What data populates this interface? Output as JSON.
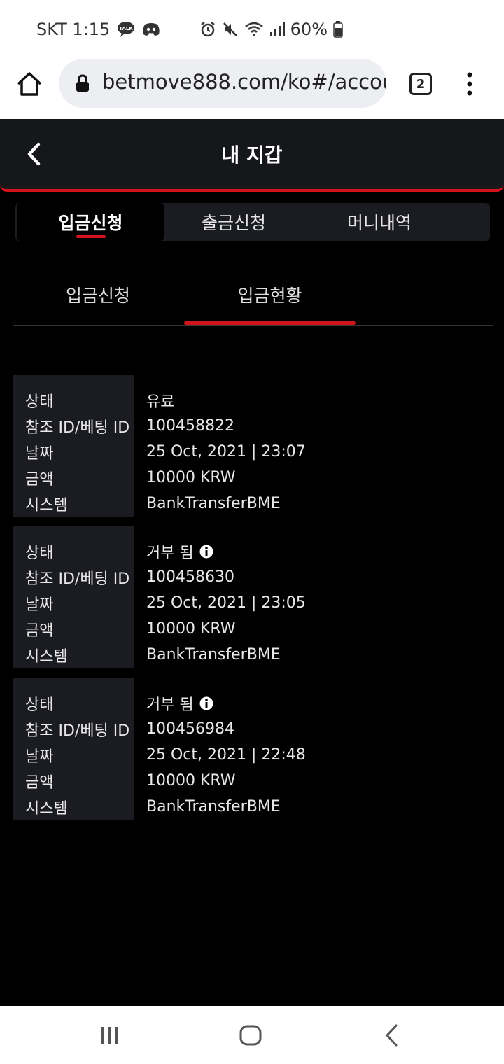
{
  "status_bar": {
    "carrier_time": "SKT 1:15",
    "battery": "60%"
  },
  "browser": {
    "url": "betmove888.com/ko#/account",
    "tab_count": "2"
  },
  "header": {
    "title": "내 지갑"
  },
  "main_tabs": [
    {
      "label": "입금신청",
      "active": true
    },
    {
      "label": "출금신청",
      "active": false
    },
    {
      "label": "머니내역",
      "active": false
    }
  ],
  "sub_tabs": [
    {
      "label": "입금신청",
      "active": false
    },
    {
      "label": "입금현황",
      "active": true
    }
  ],
  "field_labels": {
    "status": "상태",
    "ref_id": "참조 ID/베팅 ID",
    "date": "날짜",
    "amount": "금액",
    "system": "시스템"
  },
  "records": [
    {
      "status": "유료",
      "ref_id": "100458822",
      "date": "25 Oct, 2021 | 23:07",
      "amount": "10000 KRW",
      "system": "BankTransferBME",
      "has_info": false
    },
    {
      "status": "거부 됨",
      "ref_id": "100458630",
      "date": "25 Oct, 2021 | 23:05",
      "amount": "10000 KRW",
      "system": "BankTransferBME",
      "has_info": true
    },
    {
      "status": "거부 됨",
      "ref_id": "100456984",
      "date": "25 Oct, 2021 | 22:48",
      "amount": "10000 KRW",
      "system": "BankTransferBME",
      "has_info": true
    }
  ],
  "colors": {
    "accent": "#d3131b",
    "panel": "#1b1c21",
    "header_bg": "#16171b"
  }
}
